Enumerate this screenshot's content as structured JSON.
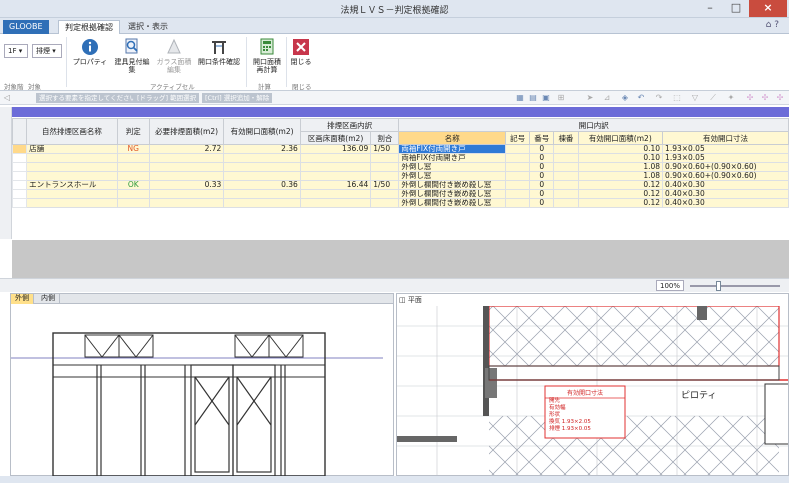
{
  "window": {
    "title": "法規ＬＶＳ－判定根拠確認",
    "minimize": "–",
    "maximize": "□",
    "close": "×"
  },
  "ribbon_tabs": {
    "gloobe": "GLOOBE",
    "active": "判定根拠確認",
    "other": "選択・表示",
    "help_icons": "⌂ ?"
  },
  "ribbon": {
    "floor_select": "1F ▾",
    "exhaust_select": "排煙 ▾",
    "buttons": {
      "property": "プロパティ",
      "fittings_list": "建具見付編集",
      "glass_ratio_line1": "ガラス面積",
      "glass_ratio_line2": "編集",
      "opening_check": "開口条件確認",
      "opening_area_line1": "開口面積",
      "opening_area_line2": "再計算",
      "close": "閉じる"
    },
    "groups": {
      "target_floor": "対象階",
      "target": "対象",
      "active_cell": "アクティブセル",
      "calc": "計算",
      "close": "閉じる"
    }
  },
  "toolbar": {
    "hint1": "選択する要素を指定してください。",
    "hint2": "[ドラッグ] 範囲選択",
    "hint3": "[Ctrl] 選択追加・解除"
  },
  "table": {
    "headers": {
      "zone_name": "自然排煙区画名称",
      "judgement": "判定",
      "required_area": "必要排煙面積(m2)",
      "effective_area": "有効開口面積(m2)",
      "zone_breakdown": "排煙区画内訳",
      "floor_area": "区画床面積(m2)",
      "ratio": "割合",
      "opening_breakdown": "開口内訳",
      "name": "名称",
      "symbol": "記号",
      "number": "番号",
      "building": "棟番",
      "opening_area": "有効開口面積(m2)",
      "opening_dims": "有効開口寸法"
    },
    "rows": [
      {
        "zone": "店舗",
        "judge": "NG",
        "required": "2.72",
        "effective": "2.36",
        "floor": "136.09",
        "ratio": "1/50",
        "name": "両袖FIX付両開き戸",
        "symbol": "",
        "number": "0",
        "building": "",
        "area": "0.10",
        "dims": "1.93×0.05"
      },
      {
        "zone": "",
        "judge": "",
        "required": "",
        "effective": "",
        "floor": "",
        "ratio": "",
        "name": "両袖FIX付両開き戸",
        "symbol": "",
        "number": "0",
        "building": "",
        "area": "0.10",
        "dims": "1.93×0.05"
      },
      {
        "zone": "",
        "judge": "",
        "required": "",
        "effective": "",
        "floor": "",
        "ratio": "",
        "name": "外倒し窓",
        "symbol": "",
        "number": "0",
        "building": "",
        "area": "1.08",
        "dims": "0.90×0.60+(0.90×0.60)"
      },
      {
        "zone": "",
        "judge": "",
        "required": "",
        "effective": "",
        "floor": "",
        "ratio": "",
        "name": "外倒し窓",
        "symbol": "",
        "number": "0",
        "building": "",
        "area": "1.08",
        "dims": "0.90×0.60+(0.90×0.60)"
      },
      {
        "zone": "エントランスホール",
        "judge": "OK",
        "required": "0.33",
        "effective": "0.36",
        "floor": "16.44",
        "ratio": "1/50",
        "name": "外倒し欄間付き嵌め殺し窓",
        "symbol": "",
        "number": "0",
        "building": "",
        "area": "0.12",
        "dims": "0.40×0.30"
      },
      {
        "zone": "",
        "judge": "",
        "required": "",
        "effective": "",
        "floor": "",
        "ratio": "",
        "name": "外倒し欄間付き嵌め殺し窓",
        "symbol": "",
        "number": "0",
        "building": "",
        "area": "0.12",
        "dims": "0.40×0.30"
      },
      {
        "zone": "",
        "judge": "",
        "required": "",
        "effective": "",
        "floor": "",
        "ratio": "",
        "name": "外倒し欄間付き嵌め殺し窓",
        "symbol": "",
        "number": "0",
        "building": "",
        "area": "0.12",
        "dims": "0.40×0.30"
      }
    ]
  },
  "zoom": {
    "value": "100%"
  },
  "panes": {
    "elevation_tab_outside": "外側",
    "elevation_tab_inside": "内側",
    "plan_label": "平面",
    "callout_title": "有効開口寸法",
    "callout_lines": [
      "開先",
      "有効幅",
      "形状",
      "換気 1.93×2.05",
      "排煙 1.93×0.05"
    ],
    "room_label": "ピロティ"
  }
}
